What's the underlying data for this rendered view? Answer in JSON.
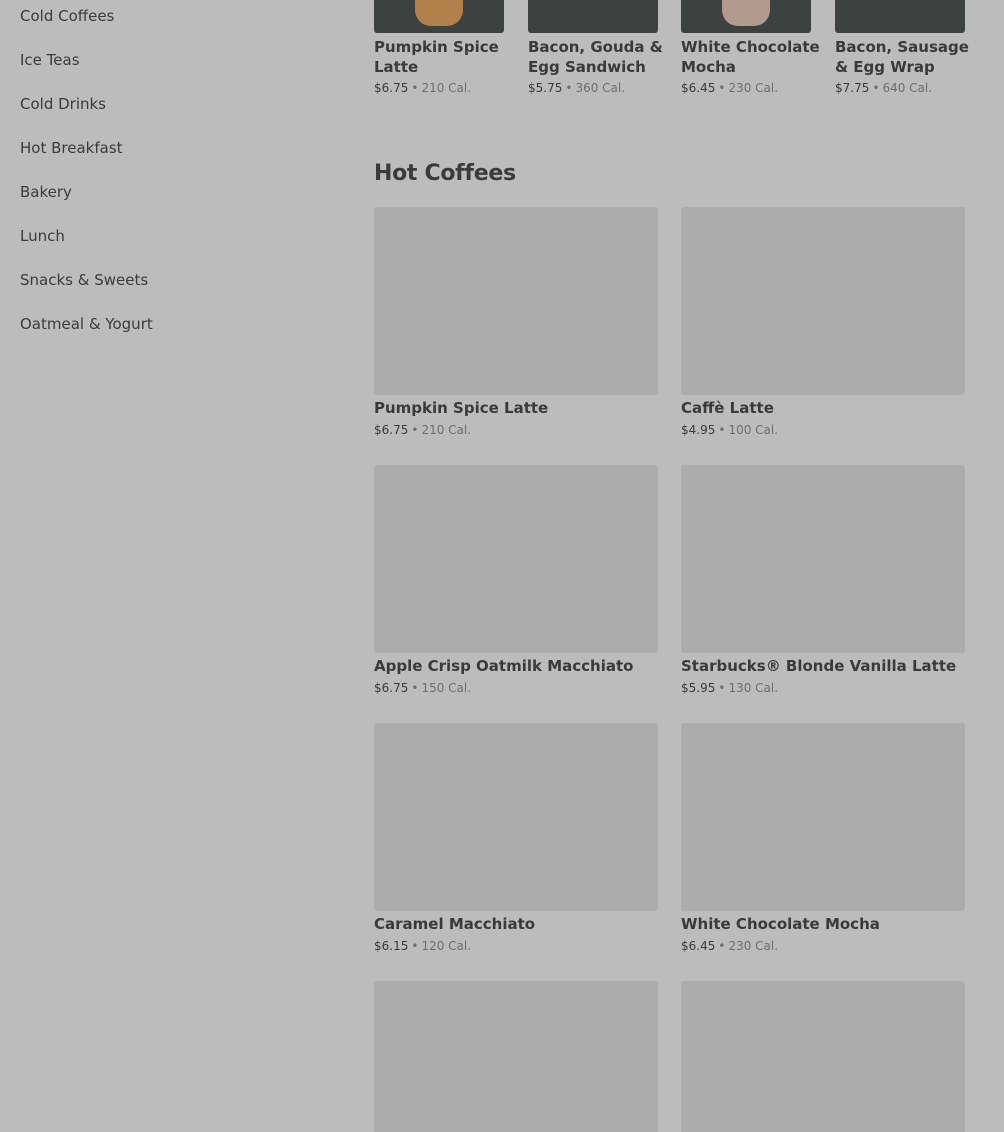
{
  "sidebar": {
    "items": [
      {
        "label": "Cold Coffees"
      },
      {
        "label": "Ice Teas"
      },
      {
        "label": "Cold Drinks"
      },
      {
        "label": "Hot Breakfast"
      },
      {
        "label": "Bakery"
      },
      {
        "label": "Lunch"
      },
      {
        "label": "Snacks & Sweets"
      },
      {
        "label": "Oatmeal & Yogurt"
      }
    ]
  },
  "featured": {
    "items": [
      {
        "name": "Pumpkin Spice Latte",
        "price": "$6.75",
        "separator": "•",
        "calories": "210 Cal."
      },
      {
        "name": "Bacon, Gouda & Egg Sandwich",
        "price": "$5.75",
        "separator": "•",
        "calories": "360 Cal."
      },
      {
        "name": "White Chocolate Mocha",
        "price": "$6.45",
        "separator": "•",
        "calories": "230 Cal."
      },
      {
        "name": "Bacon, Sausage & Egg Wrap",
        "price": "$7.75",
        "separator": "•",
        "calories": "640 Cal."
      }
    ]
  },
  "section": {
    "title": "Hot Coffees"
  },
  "products": [
    {
      "name": "Pumpkin Spice Latte",
      "price": "$6.75",
      "separator": "•",
      "calories": "210 Cal."
    },
    {
      "name": "Caffè Latte",
      "price": "$4.95",
      "separator": "•",
      "calories": "100 Cal."
    },
    {
      "name": "Apple Crisp Oatmilk Macchiato",
      "price": "$6.75",
      "separator": "•",
      "calories": "150 Cal."
    },
    {
      "name": "Starbucks® Blonde Vanilla Latte",
      "price": "$5.95",
      "separator": "•",
      "calories": "130 Cal."
    },
    {
      "name": "Caramel Macchiato",
      "price": "$6.15",
      "separator": "•",
      "calories": "120 Cal."
    },
    {
      "name": "White Chocolate Mocha",
      "price": "$6.45",
      "separator": "•",
      "calories": "230 Cal."
    },
    {
      "name": "",
      "price": "",
      "separator": "",
      "calories": ""
    },
    {
      "name": "",
      "price": "",
      "separator": "",
      "calories": ""
    }
  ],
  "colors": {
    "overlay_background": "#bcbcbc",
    "image_placeholder": "#acacac",
    "featured_image_bg": "#3c4240"
  }
}
